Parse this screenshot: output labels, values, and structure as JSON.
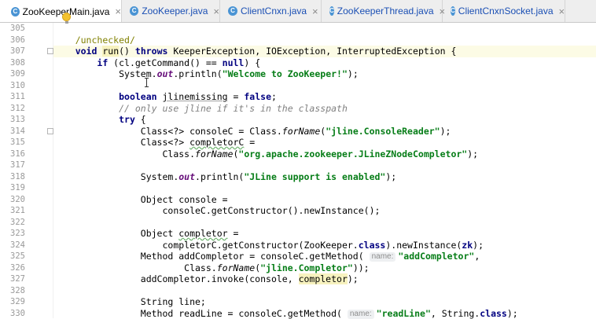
{
  "tabs": [
    {
      "label": "ZooKeeperMain.java",
      "active": true
    },
    {
      "label": "ZooKeeper.java",
      "active": false
    },
    {
      "label": "ClientCnxn.java",
      "active": false
    },
    {
      "label": "ZooKeeperThread.java",
      "active": false
    },
    {
      "label": "ClientCnxnSocket.java",
      "active": false
    }
  ],
  "tab_icon_letter": "C",
  "close_glyph": "×",
  "colors": {
    "keyword": "#000080",
    "string": "#067d17",
    "comment": "#808080",
    "annotation": "#808000",
    "tab_active_text": "#000000",
    "tab_other_text": "#1a4fb4"
  },
  "editor": {
    "lines": [
      {
        "n": "305",
        "tokens": []
      },
      {
        "n": "306",
        "tokens": [
          [
            "    ",
            ""
          ],
          [
            "/unchecked/",
            "ann"
          ]
        ]
      },
      {
        "n": "307",
        "tokens": [
          [
            "    ",
            ""
          ],
          [
            "void",
            "kw"
          ],
          [
            " ",
            ""
          ],
          [
            "run",
            "hl"
          ],
          [
            "() ",
            ""
          ],
          [
            "throws",
            "kw"
          ],
          [
            " KeeperException, IOException, InterruptedException {",
            ""
          ]
        ]
      },
      {
        "n": "308",
        "tokens": [
          [
            "        ",
            ""
          ],
          [
            "if",
            "kw"
          ],
          [
            " (cl.getCommand() == ",
            ""
          ],
          [
            "null",
            "kw"
          ],
          [
            ") {",
            ""
          ]
        ]
      },
      {
        "n": "309",
        "tokens": [
          [
            "            System.",
            ""
          ],
          [
            "out",
            "static"
          ],
          [
            ".println(",
            ""
          ],
          [
            "\"Welcome to ZooKeeper!\"",
            "str"
          ],
          [
            ");",
            ""
          ]
        ]
      },
      {
        "n": "310",
        "tokens": []
      },
      {
        "n": "311",
        "tokens": [
          [
            "            ",
            ""
          ],
          [
            "boolean",
            "kw"
          ],
          [
            " ",
            ""
          ],
          [
            "jlinemissing",
            "unused"
          ],
          [
            " = ",
            ""
          ],
          [
            "false",
            "kw"
          ],
          [
            ";",
            ""
          ]
        ]
      },
      {
        "n": "312",
        "tokens": [
          [
            "            ",
            ""
          ],
          [
            "// only use jline if it's in the classpath",
            "cmt"
          ]
        ]
      },
      {
        "n": "313",
        "tokens": [
          [
            "            ",
            ""
          ],
          [
            "try",
            "kw"
          ],
          [
            " {",
            ""
          ]
        ]
      },
      {
        "n": "314",
        "tokens": [
          [
            "                Class<?> consoleC = Class.",
            ""
          ],
          [
            "forName",
            "staticm"
          ],
          [
            "(",
            ""
          ],
          [
            "\"jline.ConsoleReader\"",
            "str"
          ],
          [
            ");",
            ""
          ]
        ]
      },
      {
        "n": "315",
        "tokens": [
          [
            "                Class<?> ",
            ""
          ],
          [
            "completorC",
            "typo"
          ],
          [
            " =",
            ""
          ]
        ]
      },
      {
        "n": "316",
        "tokens": [
          [
            "                    Class.",
            ""
          ],
          [
            "forName",
            "staticm"
          ],
          [
            "(",
            ""
          ],
          [
            "\"org.apache.zookeeper.JLineZNodeCompletor\"",
            "str"
          ],
          [
            ");",
            ""
          ]
        ]
      },
      {
        "n": "317",
        "tokens": []
      },
      {
        "n": "318",
        "tokens": [
          [
            "                System.",
            ""
          ],
          [
            "out",
            "static"
          ],
          [
            ".println(",
            ""
          ],
          [
            "\"JLine support is enabled\"",
            "str"
          ],
          [
            ");",
            ""
          ]
        ]
      },
      {
        "n": "319",
        "tokens": []
      },
      {
        "n": "320",
        "tokens": [
          [
            "                Object console =",
            ""
          ]
        ]
      },
      {
        "n": "321",
        "tokens": [
          [
            "                    consoleC.getConstructor().newInstance();",
            ""
          ]
        ]
      },
      {
        "n": "322",
        "tokens": []
      },
      {
        "n": "323",
        "tokens": [
          [
            "                Object ",
            ""
          ],
          [
            "completor",
            "typo"
          ],
          [
            " =",
            ""
          ]
        ]
      },
      {
        "n": "324",
        "tokens": [
          [
            "                    completorC.getConstructor(ZooKeeper.",
            ""
          ],
          [
            "class",
            "kw"
          ],
          [
            ").newInstance(",
            ""
          ],
          [
            "zk",
            "kw"
          ],
          [
            ");",
            ""
          ]
        ]
      },
      {
        "n": "325",
        "tokens": [
          [
            "                Method addCompletor = consoleC.getMethod( ",
            ""
          ],
          [
            "name:",
            "hint"
          ],
          [
            "\"addCompletor\"",
            "str"
          ],
          [
            ",",
            ""
          ]
        ]
      },
      {
        "n": "326",
        "tokens": [
          [
            "                        Class.",
            ""
          ],
          [
            "forName",
            "staticm"
          ],
          [
            "(",
            ""
          ],
          [
            "\"jline.Completor\"",
            "str"
          ],
          [
            "));",
            ""
          ]
        ]
      },
      {
        "n": "327",
        "tokens": [
          [
            "                addCompletor.invoke(console, ",
            ""
          ],
          [
            "completor",
            "hl"
          ],
          [
            ");",
            ""
          ]
        ]
      },
      {
        "n": "328",
        "tokens": []
      },
      {
        "n": "329",
        "tokens": [
          [
            "                String line;",
            ""
          ]
        ]
      },
      {
        "n": "330",
        "tokens": [
          [
            "                Method readLine = consoleC.getMethod( ",
            ""
          ],
          [
            "name:",
            "hint"
          ],
          [
            "\"readLine\"",
            "str"
          ],
          [
            ", String.",
            ""
          ],
          [
            "class",
            "kw"
          ],
          [
            ");",
            ""
          ]
        ]
      }
    ]
  }
}
